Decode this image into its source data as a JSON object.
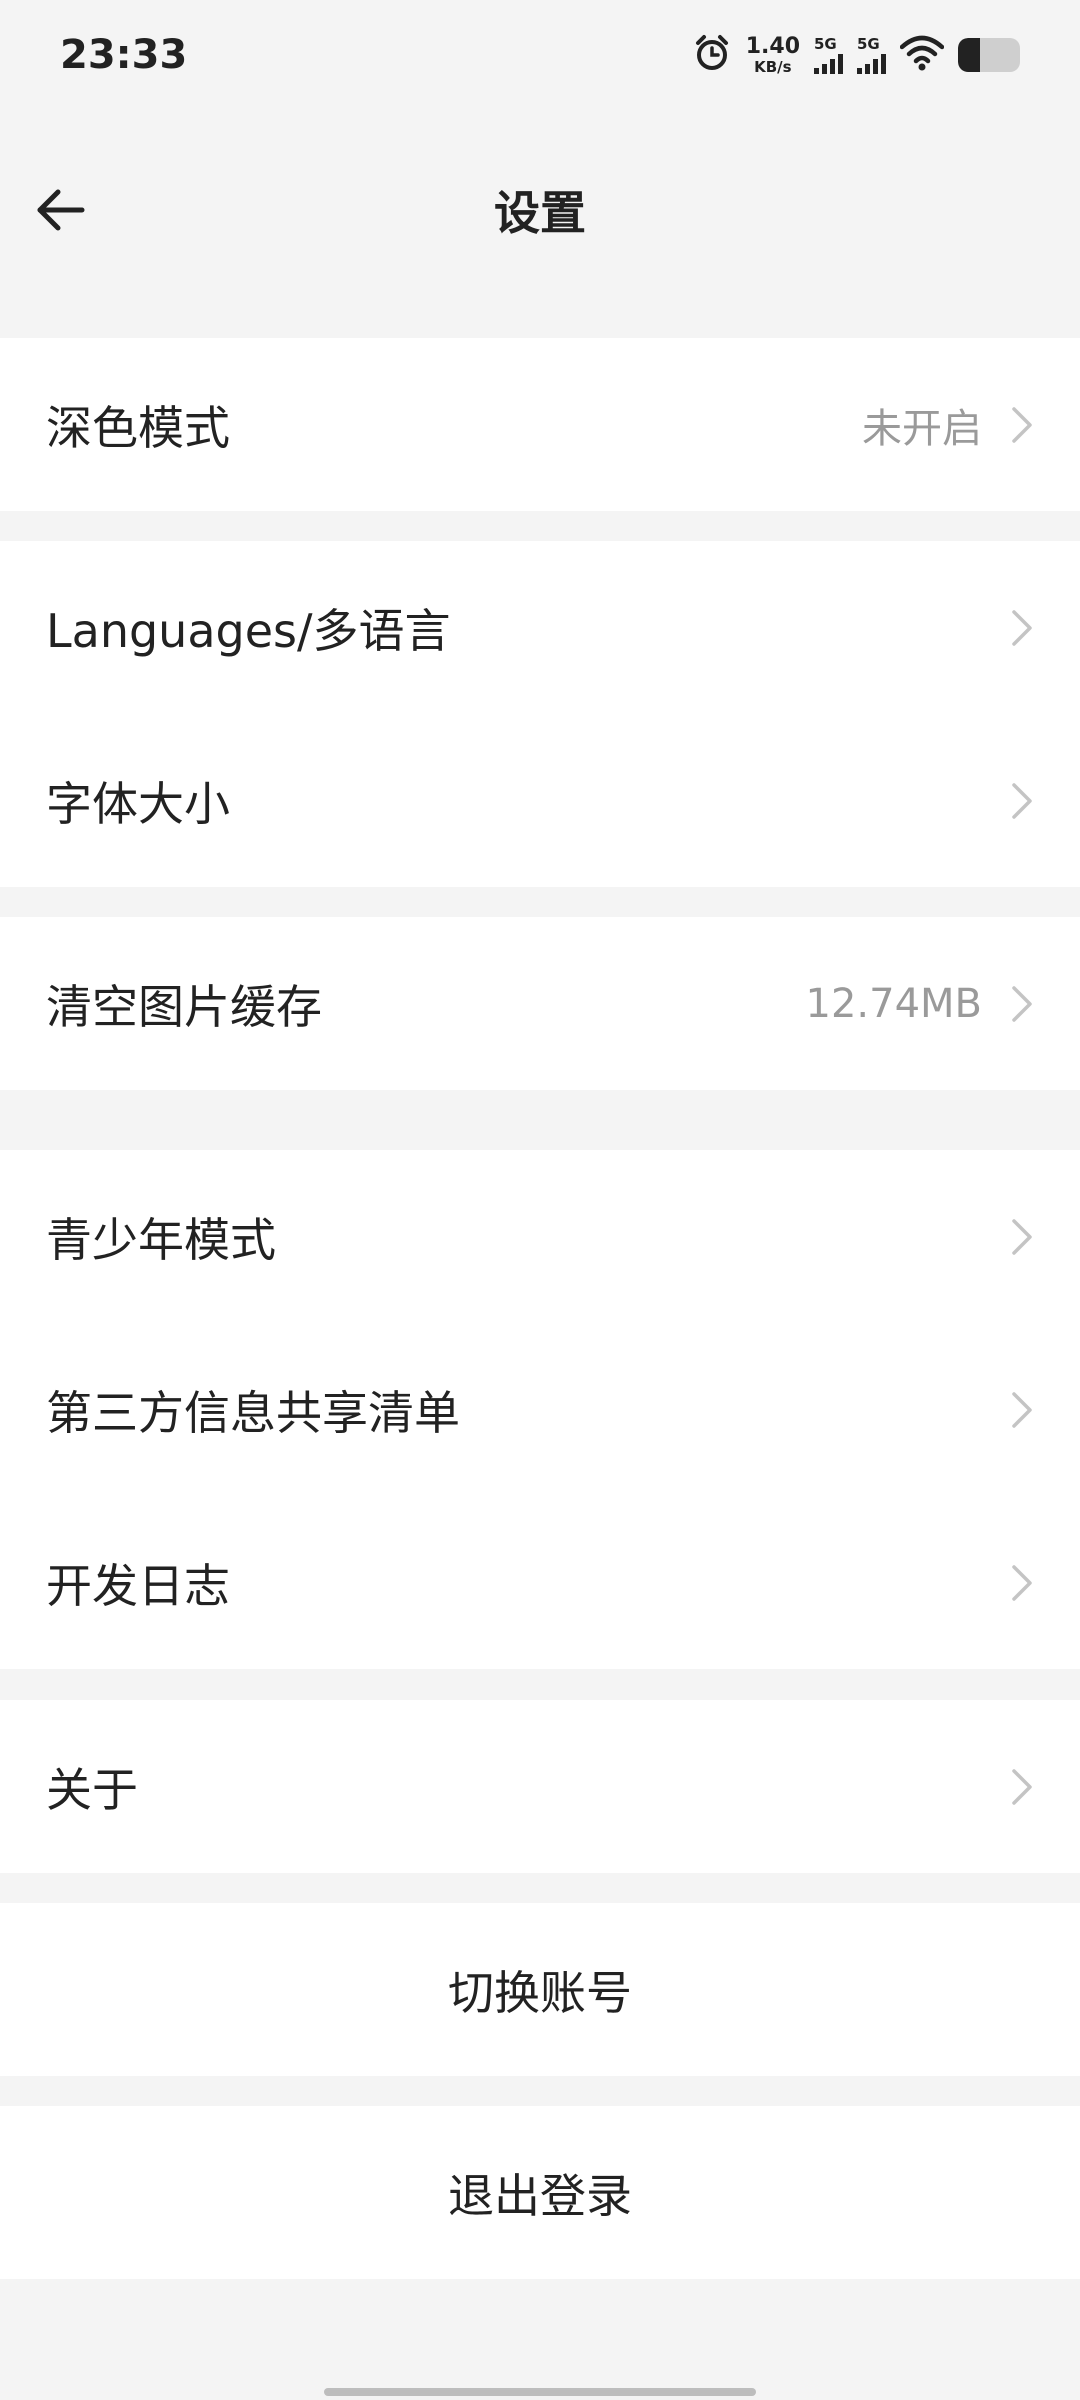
{
  "status_bar": {
    "time": "23:33",
    "alarm_icon": "alarm-icon",
    "net_speed_value": "1.40",
    "net_speed_unit": "KB/s",
    "sim1_label": "5G",
    "sim2_label": "5G",
    "wifi_icon": "wifi-icon",
    "battery_level": 0.35
  },
  "header": {
    "title": "设置",
    "back_icon": "arrow-left-icon"
  },
  "settings": {
    "dark_mode": {
      "label": "深色模式",
      "value": "未开启"
    },
    "languages": {
      "label": "Languages/多语言"
    },
    "font_size": {
      "label": "字体大小"
    },
    "clear_cache": {
      "label": "清空图片缓存",
      "value": "12.74MB"
    },
    "teen_mode": {
      "label": "青少年模式"
    },
    "third_party": {
      "label": "第三方信息共享清单"
    },
    "dev_log": {
      "label": "开发日志"
    },
    "about": {
      "label": "关于"
    }
  },
  "actions": {
    "switch_account": "切换账号",
    "logout": "退出登录"
  },
  "colors": {
    "background": "#f4f4f4",
    "card": "#ffffff",
    "text": "#222222",
    "secondary_text": "#9a9a9a",
    "chevron": "#c4c4c4"
  }
}
